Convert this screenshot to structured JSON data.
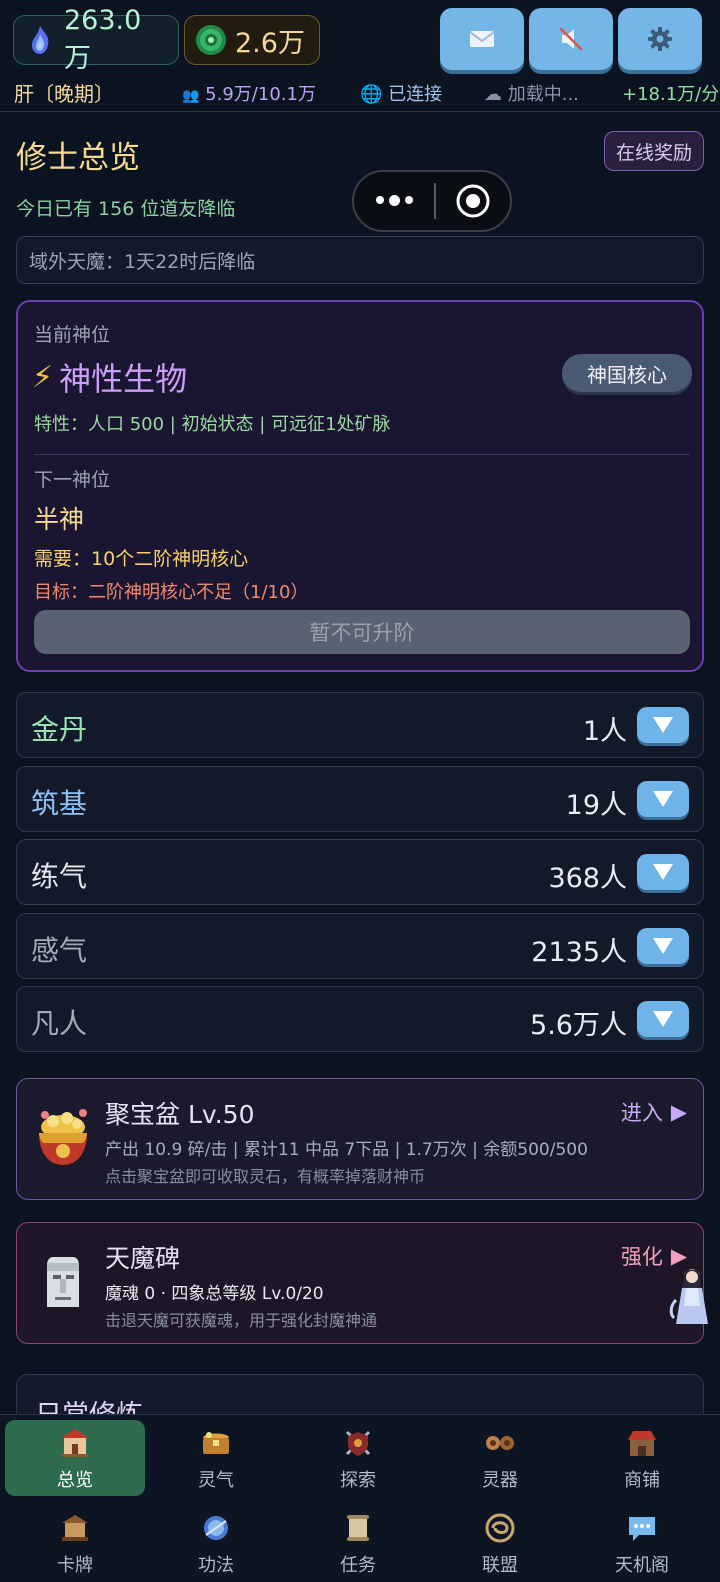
{
  "topbar": {
    "spirit_value": "263.0万",
    "coin_value": "2.6万",
    "buttons": [
      "mail-icon",
      "mute-icon",
      "gear-icon"
    ]
  },
  "status": {
    "realm": "肝〔晚期〕",
    "population": "5.9万/10.1万",
    "connection": "已连接",
    "loading": "加载中...",
    "rate": "+18.1万/分"
  },
  "overview": {
    "title": "修士总览",
    "online_reward": "在线奖励",
    "today": "今日已有 156 位道友降临",
    "demon_notice": "域外天魔：1天22时后降临"
  },
  "god_rank": {
    "current_label": "当前神位",
    "current_name": "神性生物",
    "core_button": "神国核心",
    "traits": "特性：人口 500 | 初始状态 | 可远征1处矿脉",
    "next_label": "下一神位",
    "next_name": "半神",
    "requirement": "需要：10个二阶神明核心",
    "goal": "目标：二阶神明核心不足（1/10）",
    "upgrade_button": "暂不可升阶"
  },
  "ranks": [
    {
      "name": "金丹",
      "count": "1人",
      "color": "#9ce0b4"
    },
    {
      "name": "筑基",
      "count": "19人",
      "color": "#8fc1f5"
    },
    {
      "name": "练气",
      "count": "368人",
      "color": "#e6e8ee"
    },
    {
      "name": "感气",
      "count": "2135人",
      "color": "#a3a9b6"
    },
    {
      "name": "凡人",
      "count": "5.6万人",
      "color": "#a3a9b6"
    }
  ],
  "treasure": {
    "title": "聚宝盆  Lv.50",
    "action": "进入",
    "line1": "产出 10.9 碎/击 | 累计11 中品 7下品 | 1.7万次 | 余额500/500",
    "line2": "点击聚宝盆即可收取灵石，有概率掉落财神币"
  },
  "stele": {
    "title": "天魔碑",
    "action": "强化",
    "line1": "魔魂 0  ·  四象总等级 Lv.0/20",
    "line2": "击退天魔可获魔魂，用于强化封魔神通"
  },
  "daily": {
    "title": "日常修炼"
  },
  "nav": [
    {
      "label": "总览",
      "icon": "temple-icon"
    },
    {
      "label": "灵气",
      "icon": "chest-icon"
    },
    {
      "label": "探索",
      "icon": "shield-swords-icon"
    },
    {
      "label": "灵器",
      "icon": "artifact-icon"
    },
    {
      "label": "商铺",
      "icon": "shop-icon"
    },
    {
      "label": "卡牌",
      "icon": "card-icon"
    },
    {
      "label": "功法",
      "icon": "orb-icon"
    },
    {
      "label": "任务",
      "icon": "scroll-icon"
    },
    {
      "label": "联盟",
      "icon": "alliance-icon"
    },
    {
      "label": "天机阁",
      "icon": "chat-icon"
    }
  ]
}
